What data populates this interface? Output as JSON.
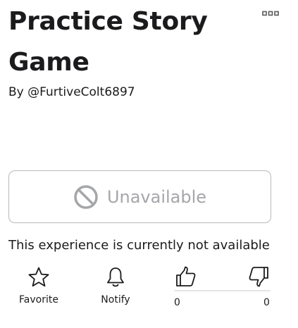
{
  "experience": {
    "title": "Practice Story Game",
    "byline_prefix": "By",
    "creator": "@FurtiveColt6897",
    "status_text": "This experience is currently not available"
  },
  "play_button": {
    "label": "Unavailable",
    "icon": "unavailable-icon"
  },
  "more_button": {
    "icon": "more-options-icon"
  },
  "actions": {
    "favorite": {
      "label": "Favorite",
      "icon": "star-icon"
    },
    "notify": {
      "label": "Notify",
      "icon": "bell-icon"
    }
  },
  "votes": {
    "up_count": "0",
    "down_count": "0",
    "up_icon": "thumbs-up-icon",
    "down_icon": "thumbs-down-icon"
  },
  "colors": {
    "text": "#1b1b1d",
    "disabled_text": "#a5a6aa",
    "border": "#b8b9bc",
    "icon": "#1b1b1d"
  }
}
